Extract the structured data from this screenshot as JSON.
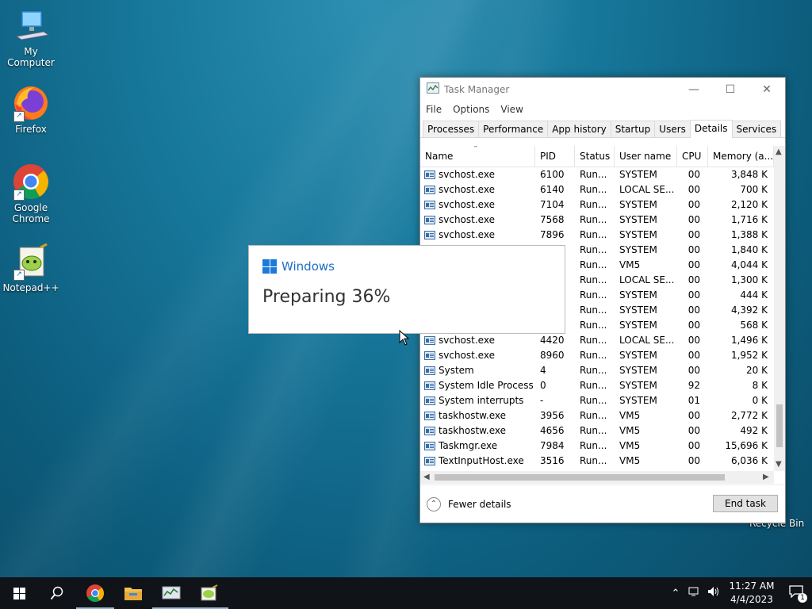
{
  "desktop": {
    "icons": [
      {
        "label": "My Computer"
      },
      {
        "label": "Firefox"
      },
      {
        "label": "Google Chrome"
      },
      {
        "label": "Notepad++"
      }
    ],
    "recycle_bin": "Recycle Bin"
  },
  "task_manager": {
    "title": "Task Manager",
    "menu": [
      "File",
      "Options",
      "View"
    ],
    "tabs": [
      "Processes",
      "Performance",
      "App history",
      "Startup",
      "Users",
      "Details",
      "Services"
    ],
    "active_tab": "Details",
    "columns": [
      "Name",
      "PID",
      "Status",
      "User name",
      "CPU",
      "Memory (a..."
    ],
    "rows": [
      [
        "svchost.exe",
        "6100",
        "Run...",
        "SYSTEM",
        "00",
        "3,848 K"
      ],
      [
        "svchost.exe",
        "6140",
        "Run...",
        "LOCAL SE...",
        "00",
        "700 K"
      ],
      [
        "svchost.exe",
        "7104",
        "Run...",
        "SYSTEM",
        "00",
        "2,120 K"
      ],
      [
        "svchost.exe",
        "7568",
        "Run...",
        "SYSTEM",
        "00",
        "1,716 K"
      ],
      [
        "svchost.exe",
        "7896",
        "Run...",
        "SYSTEM",
        "00",
        "1,388 K"
      ],
      [
        "",
        "",
        "Run...",
        "SYSTEM",
        "00",
        "1,840 K"
      ],
      [
        "",
        "",
        "Run...",
        "VM5",
        "00",
        "4,044 K"
      ],
      [
        "",
        "",
        "Run...",
        "LOCAL SE...",
        "00",
        "1,300 K"
      ],
      [
        "",
        "",
        "Run...",
        "SYSTEM",
        "00",
        "444 K"
      ],
      [
        "",
        "",
        "Run...",
        "SYSTEM",
        "00",
        "4,392 K"
      ],
      [
        "",
        "",
        "Run...",
        "SYSTEM",
        "00",
        "568 K"
      ],
      [
        "svchost.exe",
        "4420",
        "Run...",
        "LOCAL SE...",
        "00",
        "1,496 K"
      ],
      [
        "svchost.exe",
        "8960",
        "Run...",
        "SYSTEM",
        "00",
        "1,952 K"
      ],
      [
        "System",
        "4",
        "Run...",
        "SYSTEM",
        "00",
        "20 K"
      ],
      [
        "System Idle Process",
        "0",
        "Run...",
        "SYSTEM",
        "92",
        "8 K"
      ],
      [
        "System interrupts",
        "-",
        "Run...",
        "SYSTEM",
        "01",
        "0 K"
      ],
      [
        "taskhostw.exe",
        "3956",
        "Run...",
        "VM5",
        "00",
        "2,772 K"
      ],
      [
        "taskhostw.exe",
        "4656",
        "Run...",
        "VM5",
        "00",
        "492 K"
      ],
      [
        "Taskmgr.exe",
        "7984",
        "Run...",
        "VM5",
        "00",
        "15,696 K"
      ],
      [
        "TextInputHost.exe",
        "3516",
        "Run...",
        "VM5",
        "00",
        "6,036 K"
      ]
    ],
    "fewer_details": "Fewer details",
    "end_task": "End task"
  },
  "preparing_dialog": {
    "brand": "Windows",
    "message": "Preparing 36%"
  },
  "taskbar": {
    "apps": [
      "start",
      "search",
      "chrome",
      "file-explorer",
      "task-manager",
      "notepad-plus-plus"
    ],
    "time": "11:27 AM",
    "date": "4/4/2023",
    "notification_count": "1"
  }
}
